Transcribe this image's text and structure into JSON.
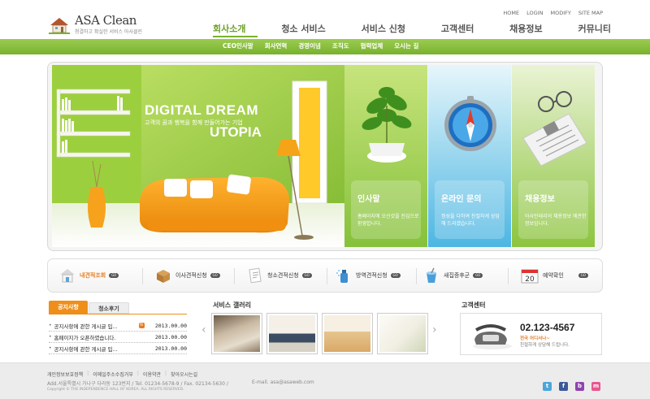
{
  "brand": {
    "name": "ASA Clean",
    "tagline": "청결하고 확실한 서비스 아사클린"
  },
  "utility": [
    "HOME",
    "LOGIN",
    "MODIFY",
    "SITE MAP"
  ],
  "gnb": [
    "회사소개",
    "청소 서비스",
    "서비스 신청",
    "고객센터",
    "채용정보",
    "커뮤니티"
  ],
  "subnav": [
    "CEO인사말",
    "회사연혁",
    "경영이념",
    "조직도",
    "협력업체",
    "오시는 길"
  ],
  "hero": {
    "title1": "DIGITAL DREAM",
    "slogan": "고객의 꿈과 행복을 함께 만들어가는 기업",
    "title2": "UTOPIA",
    "cards": [
      {
        "title": "인사말",
        "desc": "홈페이지에 오신것을 진심으로 환영합니다."
      },
      {
        "title": "온라인 문의",
        "desc": "정성을 다하여 친절하게 상담해 드리겠습니다."
      },
      {
        "title": "채용정보",
        "desc": "아사인테리어 채용정보 에관한 정보입니다."
      }
    ]
  },
  "quick": {
    "go": "GO",
    "items": [
      {
        "label": "내견적조회",
        "icon": "house-icon"
      },
      {
        "label": "이사견적신청",
        "icon": "box-icon"
      },
      {
        "label": "청소견적신청",
        "icon": "document-icon"
      },
      {
        "label": "방역견적신청",
        "icon": "spray-icon"
      },
      {
        "label": "새집증후군",
        "icon": "bucket-icon"
      },
      {
        "label": "예약확인",
        "icon": "calendar-icon"
      }
    ],
    "calendar_day": "20"
  },
  "notice": {
    "tabs": [
      "공지사항",
      "청소후기"
    ],
    "new_badge": "N",
    "rows": [
      {
        "title": "공지사항에 관한 게시글 입...",
        "date": "2013.00.00",
        "new": true
      },
      {
        "title": "홈페이지가 오픈하였습니다.",
        "date": "2013.00.00",
        "new": false
      },
      {
        "title": "공지사항에 관한 게시글 입...",
        "date": "2013.00.00",
        "new": false
      }
    ]
  },
  "gallery": {
    "title": "서비스 갤러리"
  },
  "cs": {
    "title": "고객센터",
    "phone": "02.123-4567",
    "label": "전국 어디서나~",
    "desc": "친절하게 상담해 드립니다."
  },
  "footer": {
    "links": [
      "개인정보보호정책",
      "이메일주소수집거부",
      "이용약관",
      "찾아오시는길"
    ],
    "address": "Add.서울특별시 가나구 다라동 123번지  /  Tel. 01234-5678-9  /  Fax. 02134-5630  /",
    "email": "E-mail. asa@asaweb.com",
    "copyright": "Copyright © THE INDEPENDENCE HALL OF KOREA. ALL RIGHTS RESERVED."
  },
  "colors": {
    "green": "#7ab32e",
    "orange": "#ef8f1a",
    "twitter": "#4da6d9",
    "facebook": "#3b5998",
    "blog": "#8e44ad",
    "me2day": "#e8568f"
  }
}
